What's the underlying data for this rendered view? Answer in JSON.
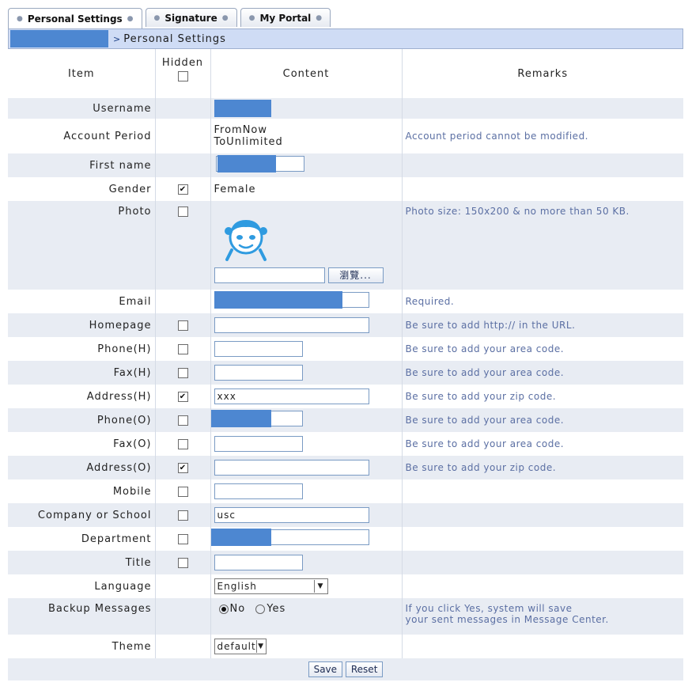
{
  "tabs": [
    {
      "label": "Personal Settings",
      "active": true
    },
    {
      "label": "Signature",
      "active": false
    },
    {
      "label": "My Portal",
      "active": false
    }
  ],
  "breadcrumb": {
    "current": "Personal Settings"
  },
  "table_header": {
    "item": "Item",
    "hidden": "Hidden",
    "content": "Content",
    "remarks": "Remarks"
  },
  "rows": {
    "username": {
      "label": "Username"
    },
    "account_period": {
      "label": "Account Period",
      "from": "FromNow",
      "to": "ToUnlimited",
      "remark": "Account period cannot be modified."
    },
    "first_name": {
      "label": "First name"
    },
    "gender": {
      "label": "Gender",
      "value": "Female",
      "hidden": true
    },
    "photo": {
      "label": "Photo",
      "remark": "Photo size: 150x200 & no more than 50 KB.",
      "browse_label": "瀏覽...",
      "hidden": false
    },
    "email": {
      "label": "Email",
      "remark": "Required."
    },
    "homepage": {
      "label": "Homepage",
      "remark": "Be sure to add http:// in the URL.",
      "hidden": false
    },
    "phone_h": {
      "label": "Phone(H)",
      "remark": "Be sure to add your area code.",
      "hidden": false
    },
    "fax_h": {
      "label": "Fax(H)",
      "remark": "Be sure to add your area code.",
      "hidden": false
    },
    "address_h": {
      "label": "Address(H)",
      "value": "xxx",
      "remark": "Be sure to add your zip code.",
      "hidden": true
    },
    "phone_o": {
      "label": "Phone(O)",
      "remark": "Be sure to add your area code.",
      "hidden": false
    },
    "fax_o": {
      "label": "Fax(O)",
      "remark": "Be sure to add your area code.",
      "hidden": false
    },
    "address_o": {
      "label": "Address(O)",
      "remark": "Be sure to add your zip code.",
      "hidden": true
    },
    "mobile": {
      "label": "Mobile",
      "hidden": false
    },
    "company": {
      "label": "Company or School",
      "value": "usc",
      "hidden": false
    },
    "department": {
      "label": "Department",
      "hidden": false
    },
    "title": {
      "label": "Title",
      "hidden": false
    },
    "language": {
      "label": "Language",
      "value": "English"
    },
    "backup": {
      "label": "Backup Messages",
      "option_no": "No",
      "option_yes": "Yes",
      "selected": "No",
      "remark_line1": "If you click Yes, system will save",
      "remark_line2": "your sent messages in Message Center."
    },
    "theme": {
      "label": "Theme",
      "value": "default"
    }
  },
  "actions": {
    "save": "Save",
    "reset": "Reset"
  },
  "colors": {
    "accent": "#4d87d1",
    "alt_row": "#e8ecf3",
    "remark_text": "#5b6fa3",
    "crumb_bg": "#cfdcf5"
  }
}
